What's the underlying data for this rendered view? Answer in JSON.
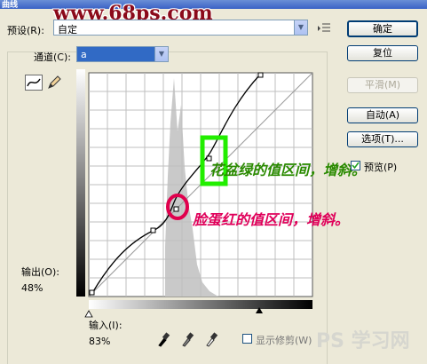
{
  "window": {
    "title": "曲线"
  },
  "watermark": "www.68ps.com",
  "preset": {
    "label": "预设(R):",
    "value": "自定"
  },
  "channel": {
    "label": "通道(C):",
    "value": "a"
  },
  "buttons": {
    "ok": "确定",
    "reset": "复位",
    "smooth": "平滑(M)",
    "auto": "自动(A)",
    "options": "选项(T)..."
  },
  "preview": {
    "label": "预览(P)",
    "checked": true
  },
  "output": {
    "label": "输出(O):",
    "value": "48%"
  },
  "input": {
    "label": "输入(I):",
    "value": "83%"
  },
  "show_clipping": {
    "label": "显示修剪(W)"
  },
  "annotations": {
    "green_note": "花盆绿的值区间，增斜。",
    "red_note": "脸蛋红的值区间，增斜。"
  },
  "bottom_watermark": "PS 学习网",
  "colors": {
    "green_note": "#2a8a00",
    "green_box": "#22ee00",
    "red_note": "#e0005a",
    "red_circle": "#e0004d",
    "watermark": "#8b0a1a"
  },
  "icons": [
    "curve-tool-icon",
    "pencil-icon",
    "preset-menu-icon",
    "black-eyedropper-icon",
    "gray-eyedropper-icon",
    "white-eyedropper-icon"
  ]
}
